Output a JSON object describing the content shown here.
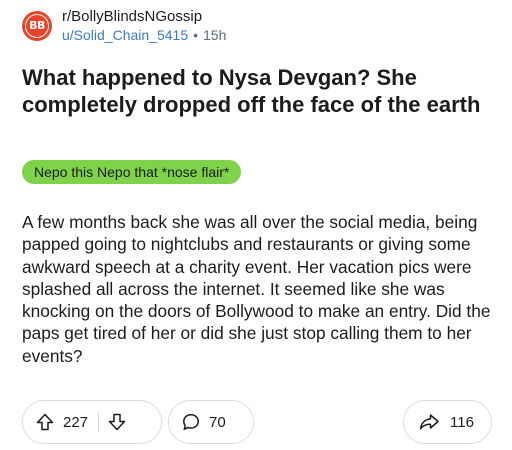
{
  "post": {
    "subreddit": "r/BollyBlindsNGossip",
    "author": "u/Solid_Chain_5415",
    "separator": "•",
    "age": "15h",
    "title": "What happened to Nysa Devgan? She completely dropped off the face of the earth",
    "flair": "Nepo this Nepo that *nose flair*",
    "body": "A few months back she was all over the social media, being papped going to nightclubs and restaurants or giving some awkward speech at a charity event. Her vacation pics were splashed all across the internet.  It seemed like she was knocking on the doors of Bollywood to make an entry. Did the paps get tired of her or did she just stop calling them to her events?"
  },
  "actions": {
    "votes": "227",
    "comments": "70",
    "shares": "116"
  },
  "colors": {
    "flair_background": "#7ed34a",
    "avatar": "#e8432b",
    "username": "#3a7bc8",
    "meta_gray": "#576f76",
    "pill_border": "#dadde0"
  },
  "icons": {
    "avatar": "subreddit-avatar",
    "upvote": "arrow-up-icon",
    "downvote": "arrow-down-icon",
    "comment": "comment-bubble-icon",
    "share": "share-arrow-icon"
  }
}
